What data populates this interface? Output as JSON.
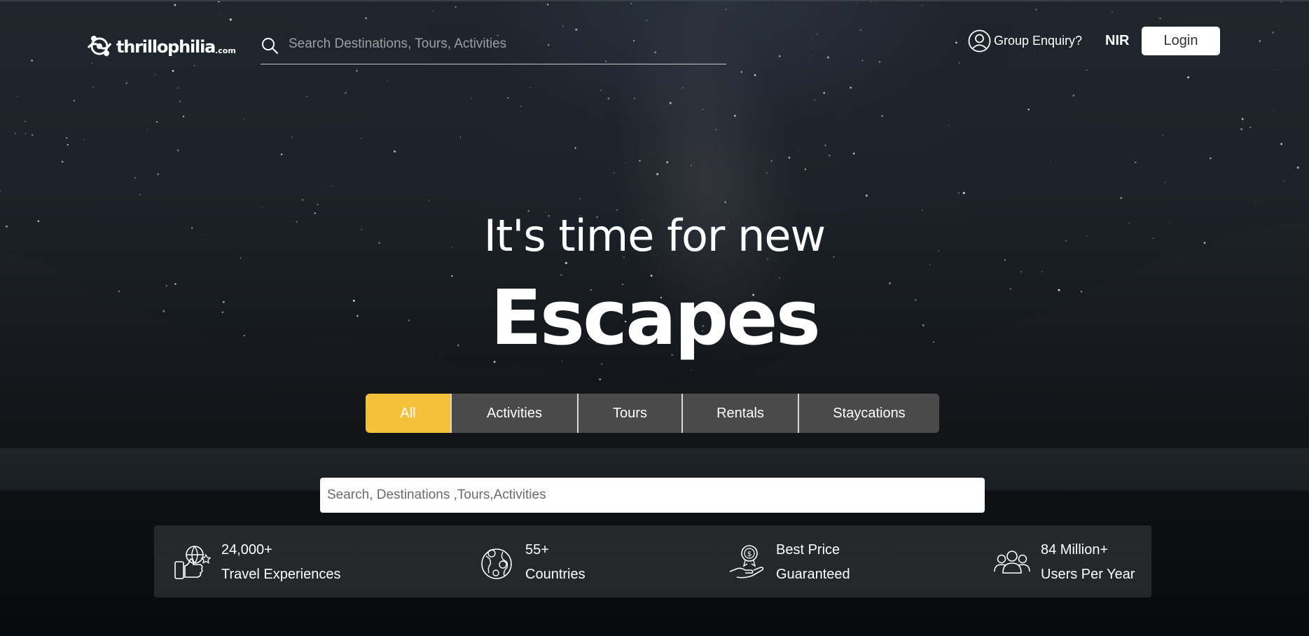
{
  "header": {
    "logo_text": "thrillophilia",
    "logo_domain": ".com",
    "search_placeholder": "Search Destinations, Tours, Activities",
    "group_enquiry": "Group Enquiry?",
    "currency": "NIR",
    "login": "Login"
  },
  "hero": {
    "line1": "It's time for new",
    "line2": "Escapes"
  },
  "tabs": [
    {
      "label": "All",
      "active": true
    },
    {
      "label": "Activities",
      "active": false
    },
    {
      "label": "Tours",
      "active": false
    },
    {
      "label": "Rentals",
      "active": false
    },
    {
      "label": "Staycations",
      "active": false
    }
  ],
  "main_search": {
    "placeholder": "Search, Destinations ,Tours,Activities"
  },
  "stats": [
    {
      "value": "24,000+",
      "label": "Travel Experiences",
      "icon": "travel-experience-icon"
    },
    {
      "value": "55+",
      "label": "Countries",
      "icon": "globe-icon"
    },
    {
      "value": "Best Price",
      "label": "Guaranteed",
      "icon": "price-badge-icon"
    },
    {
      "value": "84 Million+",
      "label": "Users Per Year",
      "icon": "users-icon"
    }
  ],
  "colors": {
    "accent": "#f5c13b",
    "tab_bg": "#4a4a4a",
    "login_bg": "#ffffff"
  }
}
